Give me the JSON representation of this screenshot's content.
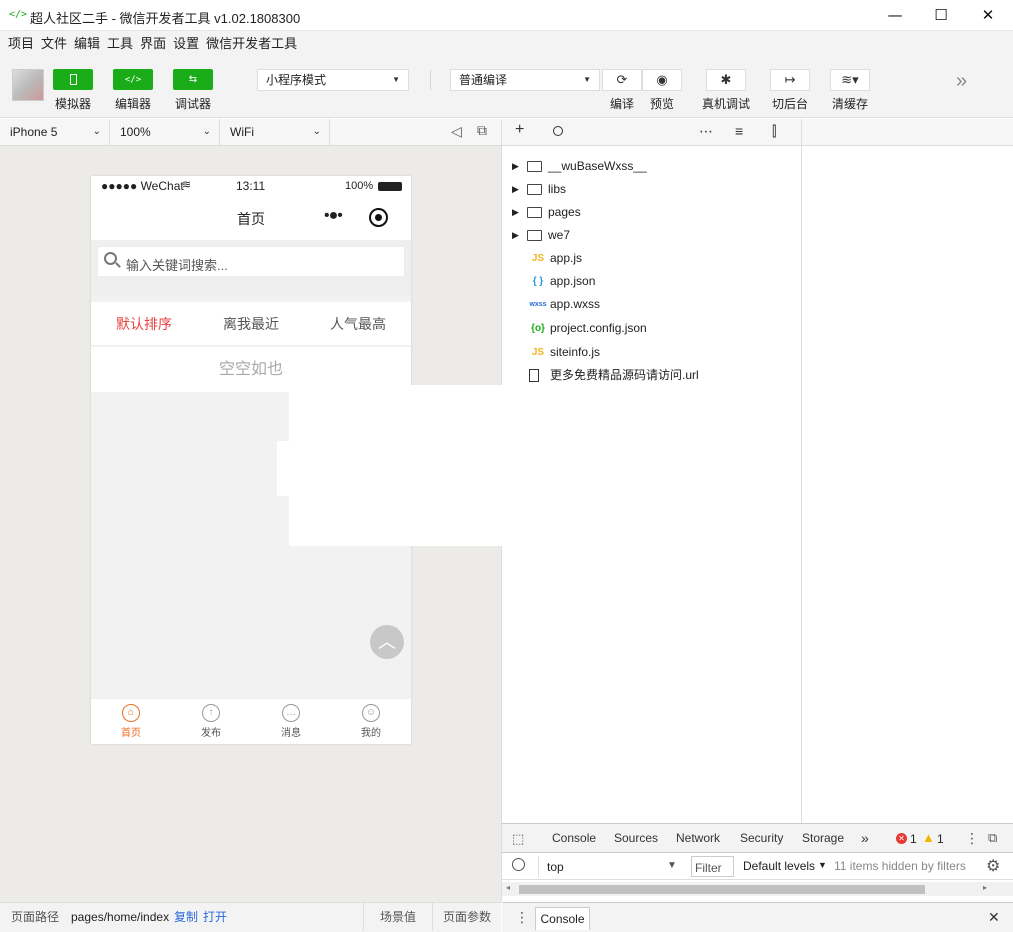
{
  "window": {
    "title": "超人社区二手 - 微信开发者工具 v1.02.1808300",
    "logo_glyph": "</>",
    "minimize": "—",
    "maximize": "☐",
    "close": "✕"
  },
  "menu": [
    "项目",
    "文件",
    "编辑",
    "工具",
    "界面",
    "设置",
    "微信开发者工具"
  ],
  "toolbar": {
    "simulator_label": "模拟器",
    "editor_label": "编辑器",
    "debugger_label": "调试器",
    "mode_select": "小程序模式",
    "compile_select": "普通编译",
    "compile_label": "编译",
    "preview_label": "预览",
    "remote_debug_label": "真机调试",
    "background_label": "切后台",
    "clear_cache_label": "清缓存",
    "more_glyph": "»"
  },
  "device_bar": {
    "device": "iPhone 5",
    "zoom": "100%",
    "network": "WiFi"
  },
  "phone": {
    "status": {
      "signal": "●●●●● WeChat",
      "time": "13:11",
      "battery": "100%"
    },
    "nav_title": "首页",
    "search_placeholder": "输入关键词搜索...",
    "sort_tabs": [
      "默认排序",
      "离我最近",
      "人气最高"
    ],
    "active_sort_color": "#e64340",
    "empty_text": "空空如也",
    "tabbar": [
      {
        "label": "首页",
        "icon": "home-icon",
        "active": true
      },
      {
        "label": "发布",
        "icon": "upload-icon",
        "active": false
      },
      {
        "label": "消息",
        "icon": "message-icon",
        "active": false
      },
      {
        "label": "我的",
        "icon": "user-icon",
        "active": false
      }
    ],
    "accent_color": "#ee6d23"
  },
  "file_tree": [
    {
      "name": "__wuBaseWxss__",
      "type": "folder"
    },
    {
      "name": "libs",
      "type": "folder"
    },
    {
      "name": "pages",
      "type": "folder"
    },
    {
      "name": "we7",
      "type": "folder"
    },
    {
      "name": "app.js",
      "type": "js",
      "badge": "JS"
    },
    {
      "name": "app.json",
      "type": "json",
      "badge": "{ }"
    },
    {
      "name": "app.wxss",
      "type": "wxss",
      "badge": "wxss"
    },
    {
      "name": "project.config.json",
      "type": "config",
      "badge": "{o}"
    },
    {
      "name": "siteinfo.js",
      "type": "js",
      "badge": "JS"
    },
    {
      "name": "更多免费精品源码请访问.url",
      "type": "file",
      "badge": ""
    }
  ],
  "devtools": {
    "tabs": [
      "Console",
      "Sources",
      "Network",
      "Security",
      "Storage"
    ],
    "more_tabs_glyph": "»",
    "errors": "1",
    "warnings": "1",
    "context": "top",
    "filter_placeholder": "Filter",
    "levels": "Default levels",
    "hidden_note": "11 items hidden by filters",
    "drawer_tab": "Console"
  },
  "path_bar": {
    "label": "页面路径",
    "path": "pages/home/index",
    "copy": "复制",
    "open": "打开",
    "scene": "场景值",
    "params": "页面参数"
  },
  "brand_color": "#1aad19"
}
